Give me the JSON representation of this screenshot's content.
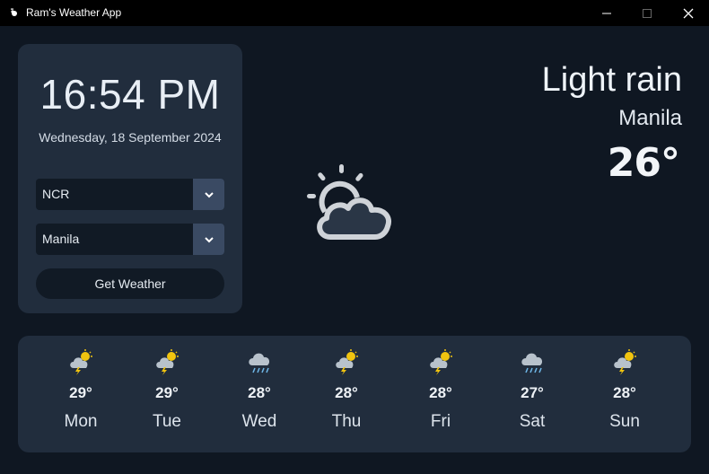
{
  "window": {
    "title": "Ram's Weather App",
    "icon": "app-icon",
    "controls": [
      "minimize-icon",
      "maximize-icon",
      "close-icon"
    ]
  },
  "clock": {
    "time": "16:54 PM",
    "date": "Wednesday, 18 September 2024"
  },
  "controls": {
    "region": {
      "value": "NCR"
    },
    "city": {
      "value": "Manila"
    },
    "button_label": "Get Weather"
  },
  "current": {
    "condition": "Light rain",
    "city": "Manila",
    "temperature": "26°",
    "icon": "sun-behind-cloud-icon"
  },
  "forecast": [
    {
      "day": "Mon",
      "temp": "29°",
      "icon": "thunder-sun-cloud-icon"
    },
    {
      "day": "Tue",
      "temp": "29°",
      "icon": "thunder-sun-cloud-icon"
    },
    {
      "day": "Wed",
      "temp": "28°",
      "icon": "rain-cloud-icon"
    },
    {
      "day": "Thu",
      "temp": "28°",
      "icon": "thunder-sun-cloud-icon"
    },
    {
      "day": "Fri",
      "temp": "28°",
      "icon": "thunder-sun-cloud-icon"
    },
    {
      "day": "Sat",
      "temp": "27°",
      "icon": "rain-cloud-icon"
    },
    {
      "day": "Sun",
      "temp": "28°",
      "icon": "thunder-sun-cloud-icon"
    }
  ],
  "colors": {
    "background": "#0f1722",
    "card": "#212d3d",
    "input": "#111a25",
    "dropdown_accent": "#3a4a63",
    "titlebar": "#000000"
  }
}
